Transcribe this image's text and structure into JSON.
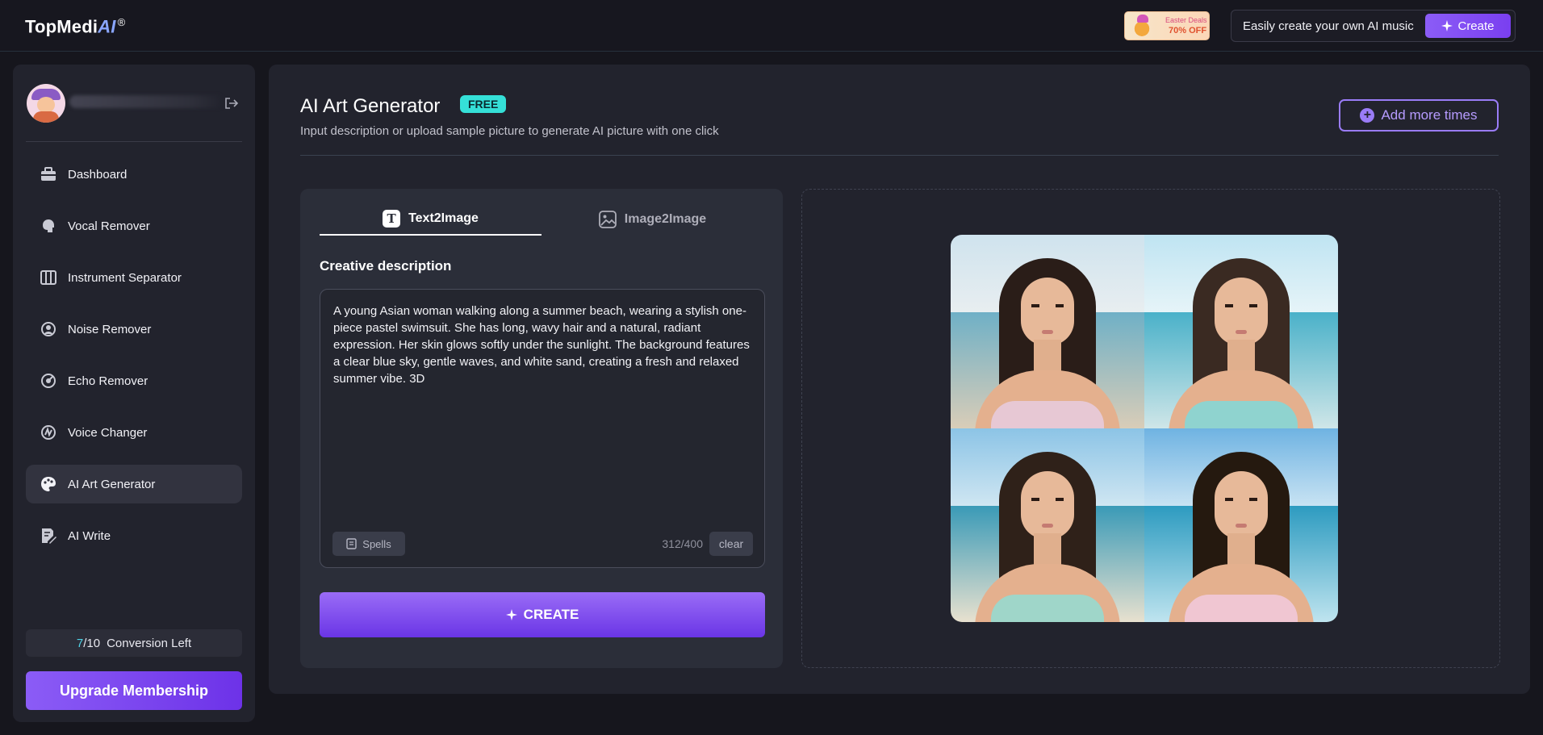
{
  "header": {
    "logo_main": "TopMedi",
    "logo_ai": "AI",
    "logo_mark": "®",
    "promo_line1": "Easter Deals",
    "promo_line2": "70% OFF",
    "music_text": "Easily create your own AI music",
    "create_label": "Create"
  },
  "sidebar": {
    "items": [
      {
        "label": "Dashboard",
        "icon": "briefcase-icon"
      },
      {
        "label": "Vocal Remover",
        "icon": "head-voice-icon"
      },
      {
        "label": "Instrument Separator",
        "icon": "piano-icon"
      },
      {
        "label": "Noise Remover",
        "icon": "noise-icon"
      },
      {
        "label": "Echo Remover",
        "icon": "echo-icon"
      },
      {
        "label": "Voice Changer",
        "icon": "voice-changer-icon"
      },
      {
        "label": "AI Art Generator",
        "icon": "palette-icon",
        "active": true
      },
      {
        "label": "AI Write",
        "icon": "write-icon"
      }
    ],
    "conversion": {
      "used": "7",
      "total": "/10",
      "label": "Conversion Left"
    },
    "upgrade_label": "Upgrade Membership"
  },
  "main": {
    "title": "AI Art Generator",
    "badge": "FREE",
    "subtitle": "Input description or upload sample picture to generate AI picture with one click",
    "add_more_label": "Add more times",
    "tabs": [
      {
        "label": "Text2Image",
        "active": true
      },
      {
        "label": "Image2Image",
        "active": false
      }
    ],
    "creative_label": "Creative description",
    "description": "A young Asian woman walking along a summer beach, wearing a stylish one-piece pastel swimsuit. She has long, wavy hair and a natural, radiant expression. Her skin glows softly under the sunlight. The background features a clear blue sky, gentle waves, and white sand, creating a fresh and relaxed summer vibe. 3D",
    "spells_label": "Spells",
    "counter": "312/400",
    "clear_label": "clear",
    "create_label": "CREATE"
  },
  "colors": {
    "accent": "#8b5cf6",
    "free_badge": "#35e0d8",
    "background": "#16161d",
    "panel": "#22232d"
  }
}
